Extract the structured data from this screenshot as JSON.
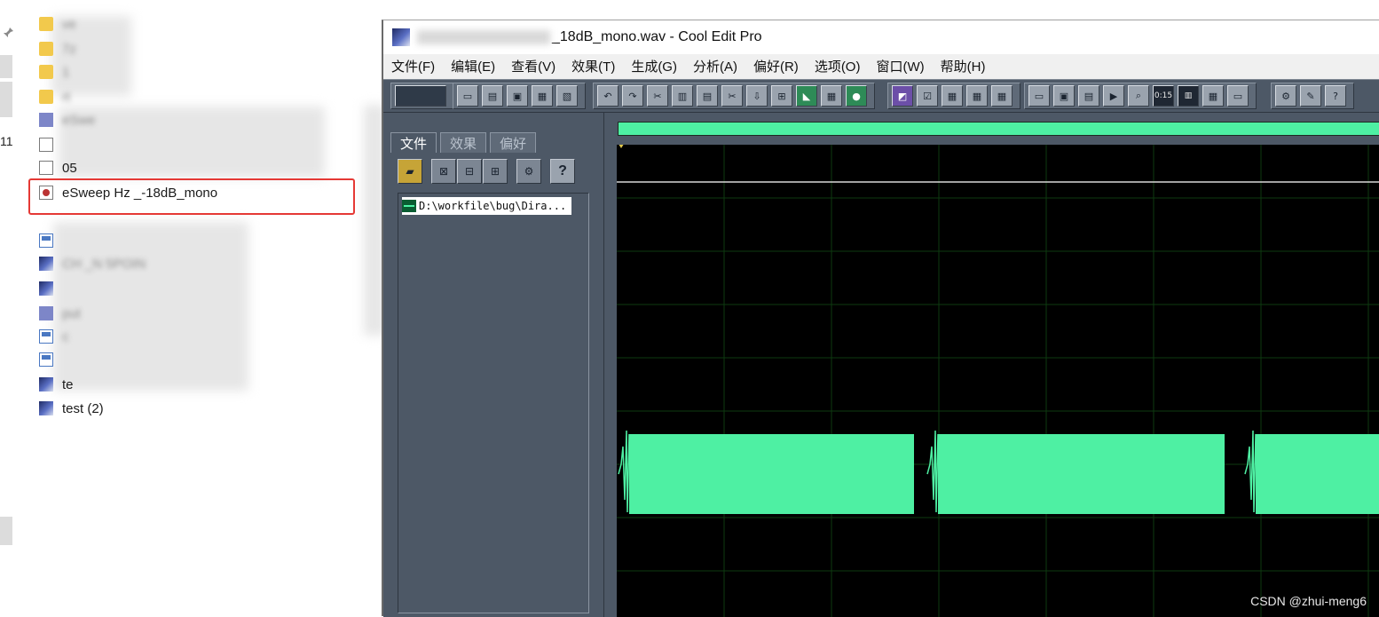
{
  "explorer": {
    "edge_label": "11",
    "files": [
      {
        "label": "ve",
        "icon": "folder-icon"
      },
      {
        "label": "7z",
        "icon": "folder-icon"
      },
      {
        "label": "1",
        "icon": "folder-icon"
      },
      {
        "label": "rt",
        "icon": "folder-icon"
      },
      {
        "label": "eSwe",
        "icon": "media-icon"
      },
      {
        "label": "",
        "icon": "document-icon"
      },
      {
        "label": "05",
        "icon": "document-icon"
      },
      {
        "label": "eSweep     Hz _-18dB_mono",
        "icon": "sound-file-icon"
      },
      {
        "label": "",
        "icon": "app-icon"
      },
      {
        "label": "CH     _N 5POIN",
        "icon": "cool-edit-icon"
      },
      {
        "label": "",
        "icon": "cool-edit-icon"
      },
      {
        "label": "put",
        "icon": "media-icon"
      },
      {
        "label": "c",
        "icon": "app-icon"
      },
      {
        "label": "",
        "icon": "app-icon"
      },
      {
        "label": "te",
        "icon": "cool-edit-icon"
      },
      {
        "label": "test     (2)",
        "icon": "cool-edit-icon"
      }
    ]
  },
  "window": {
    "title": "_18dB_mono.wav - Cool Edit Pro",
    "menu": [
      "文件(F)",
      "编辑(E)",
      "查看(V)",
      "效果(T)",
      "生成(G)",
      "分析(A)",
      "偏好(R)",
      "选项(O)",
      "窗口(W)",
      "帮助(H)"
    ]
  },
  "toolbar": {
    "time_button": "0:15",
    "help_glyph": "?"
  },
  "panel": {
    "tabs": [
      "文件",
      "效果",
      "偏好"
    ],
    "help_glyph": "?",
    "file_entry": "D:\\workfile\\bug\\Dira..."
  },
  "colors": {
    "waveform": "#4ef0a3",
    "grid": "#0e3a10",
    "background": "#000000",
    "panel": "#4d5866",
    "highlight": "#e53935"
  },
  "watermark": "CSDN @zhui-meng6"
}
